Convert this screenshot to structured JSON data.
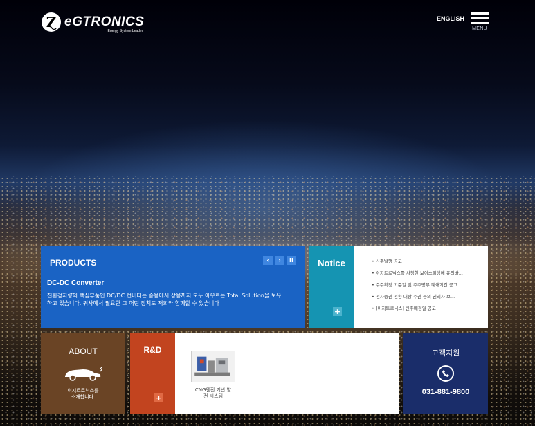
{
  "header": {
    "logo_mark": "Ɀ",
    "logo_word": "eGTRONICS",
    "logo_tagline": "Energy System Leader",
    "language": "ENGLISH",
    "menu_label": "MENU"
  },
  "products": {
    "title": "PRODUCTS",
    "controls": {
      "prev": "‹",
      "next": "›",
      "pause": "II"
    },
    "subtitle": "DC-DC Converter",
    "description": "친환경차량의 핵심부품인 DC/DC 컨버터는 승용에서 상용까지 모두 아우르는 Total Solution을 보유하고 있습니다. 귀사에서 필요한 그 어떤 장치도 저희와 함께할 수 있습니다"
  },
  "notice": {
    "title": "Notice",
    "plus": "+",
    "items": [
      "신주발행 공고",
      "이지트로닉스를 사칭한 보이스피싱에 유의바...",
      "주주확정 기준일 및 주주명부 폐쇄기간 공고",
      "전자증권 전환 대상 주권 등의 권리자 보...",
      "[이지트로닉스] 신주배정일 공고"
    ]
  },
  "about": {
    "title": "ABOUT",
    "description_line1": "이지트로닉스를",
    "description_line2": "소개합니다."
  },
  "rnd": {
    "title": "R&D",
    "plus": "+",
    "caption_line1": "CNG엔진 기반 발",
    "caption_line2": "전 시스템"
  },
  "support": {
    "title": "고객지원",
    "phone": "031-881-9800"
  },
  "colors": {
    "products_bg": "#1a63c4",
    "notice_tab": "#1594b2",
    "about_bg": "#6a4425",
    "rnd_tab": "#c2441f",
    "support_bg": "#1a2d6a"
  }
}
